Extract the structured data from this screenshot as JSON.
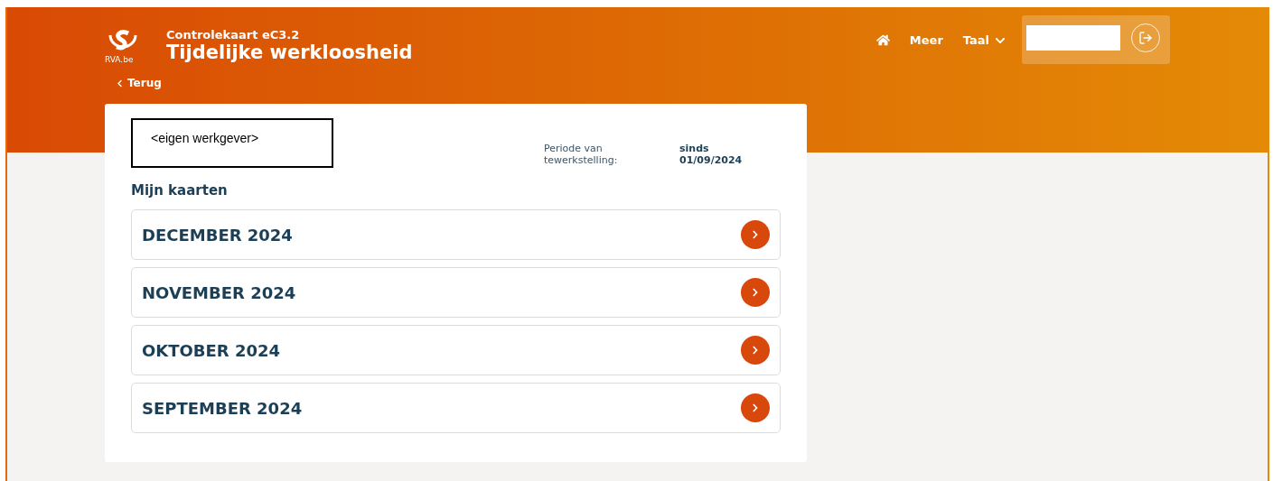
{
  "header": {
    "subtitle": "Controlekaart eC3.2",
    "title": "Tijdelijke werkloosheid",
    "logo_text": "RVA.be",
    "back": "Terug"
  },
  "nav": {
    "items": [
      {
        "kind": "home"
      },
      {
        "kind": "link",
        "label": "Meer"
      },
      {
        "kind": "dropdown",
        "label": "Taal"
      }
    ]
  },
  "card": {
    "employer": "<eigen werkgever>",
    "period_label": "Periode van tewerkstelling:",
    "period_value": "sinds 01/09/2024",
    "section_title": "Mijn kaarten",
    "months": [
      {
        "label": "DECEMBER 2024"
      },
      {
        "label": "NOVEMBER 2024"
      },
      {
        "label": "OKTOBER 2024"
      },
      {
        "label": "SEPTEMBER 2024"
      }
    ]
  }
}
